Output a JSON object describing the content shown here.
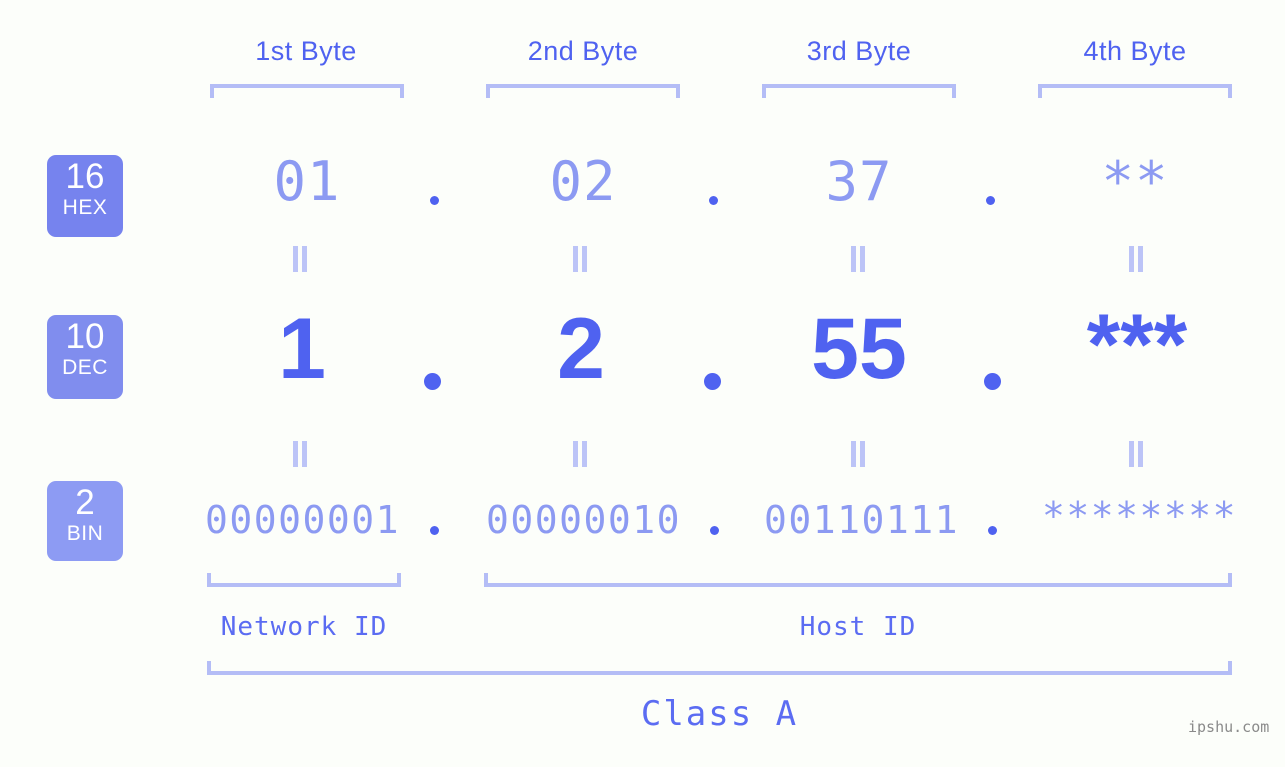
{
  "meta": {
    "background_color": "#fcfefa",
    "accent_color": "#4f62f0",
    "light_accent_color": "#8c9af2",
    "bracket_color": "#b4bdf6",
    "watermark": "ipshu.com"
  },
  "byte_headers": [
    {
      "label": "1st Byte"
    },
    {
      "label": "2nd Byte"
    },
    {
      "label": "3rd Byte"
    },
    {
      "label": "4th Byte"
    }
  ],
  "rows": [
    {
      "badge": {
        "number": "16",
        "name": "HEX",
        "color": "#7683ee"
      },
      "values": [
        "01",
        "02",
        "37",
        "**"
      ],
      "separator": "."
    },
    {
      "badge": {
        "number": "10",
        "name": "DEC",
        "color": "#808dee"
      },
      "values": [
        "1",
        "2",
        "55",
        "***"
      ],
      "separator": "."
    },
    {
      "badge": {
        "number": "2",
        "name": "BIN",
        "color": "#8d9bf3"
      },
      "values": [
        "00000001",
        "00000010",
        "00110111",
        "********"
      ],
      "separator": "."
    }
  ],
  "equals_symbol": "=",
  "sections": [
    {
      "label": "Network ID"
    },
    {
      "label": "Host ID"
    }
  ],
  "class": {
    "label": "Class A"
  }
}
